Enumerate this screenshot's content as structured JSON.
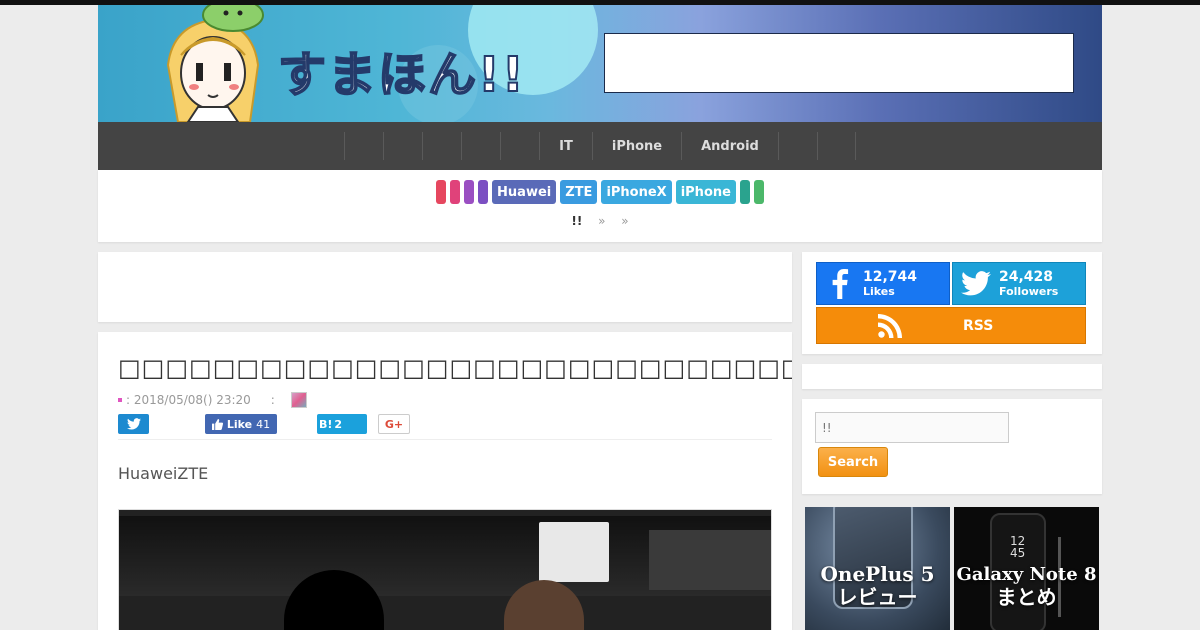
{
  "site": {
    "logo_text": "すまほん!!",
    "search_placeholder": ""
  },
  "nav": {
    "items": [
      "",
      "",
      "",
      "",
      "",
      "IT",
      "iPhone",
      "Android",
      "",
      ""
    ]
  },
  "tags": [
    {
      "label": "",
      "color": "#e6475f"
    },
    {
      "label": "",
      "color": "#e0427a"
    },
    {
      "label": "",
      "color": "#9a4fc2"
    },
    {
      "label": "",
      "color": "#7b4fc2"
    },
    {
      "label": "Huawei",
      "color": "#5a6ab8"
    },
    {
      "label": "ZTE",
      "color": "#3a9be0"
    },
    {
      "label": "iPhoneX",
      "color": "#3aa8e0"
    },
    {
      "label": "iPhone",
      "color": "#3ab6d6"
    },
    {
      "label": "",
      "color": "#2aa38e"
    },
    {
      "label": "",
      "color": "#4cb86a"
    }
  ],
  "breadcrumb": {
    "home": "!!",
    "sep1": "»",
    "sep2": "»"
  },
  "article": {
    "title": "□□□□□□□□□□□□□□□□□□□□□□□□□□□□□□□□□□□□□□□",
    "date": ": 2018/05/08() 23:20",
    "author_sep": ":",
    "lead": "HuaweiZTE"
  },
  "share": {
    "fb_like": "Like",
    "fb_count": "41",
    "hatena": "B!",
    "hatena_count": "2",
    "gplus": "G+"
  },
  "social": {
    "facebook": {
      "count": "12,744",
      "label": "Likes"
    },
    "twitter": {
      "count": "24,428",
      "label": "Followers"
    },
    "rss": "RSS"
  },
  "search": {
    "value": "!!",
    "button": "Search"
  },
  "promos": [
    {
      "line1": "OnePlus 5",
      "line2": "レビュー"
    },
    {
      "line1": "Galaxy Note 8",
      "line2": "まとめ",
      "time": "12\n45"
    }
  ]
}
